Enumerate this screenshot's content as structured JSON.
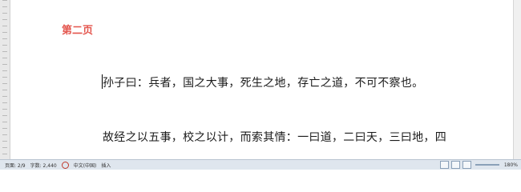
{
  "document": {
    "heading": "第二页",
    "paragraphs": [
      "孙子曰：兵者，国之大事，死生之地，存亡之道，不可不察也。",
      "故经之以五事，校之以计，而索其情：一曰道，二曰天，三曰地，四"
    ]
  },
  "statusbar": {
    "page": "页面: 2/9",
    "words": "字数: 2,440",
    "language": "中文(中国)",
    "mode": "插入",
    "zoom": "180%"
  },
  "colors": {
    "heading": "#e4564e",
    "statusbar_bg": "#dfe6ee"
  }
}
